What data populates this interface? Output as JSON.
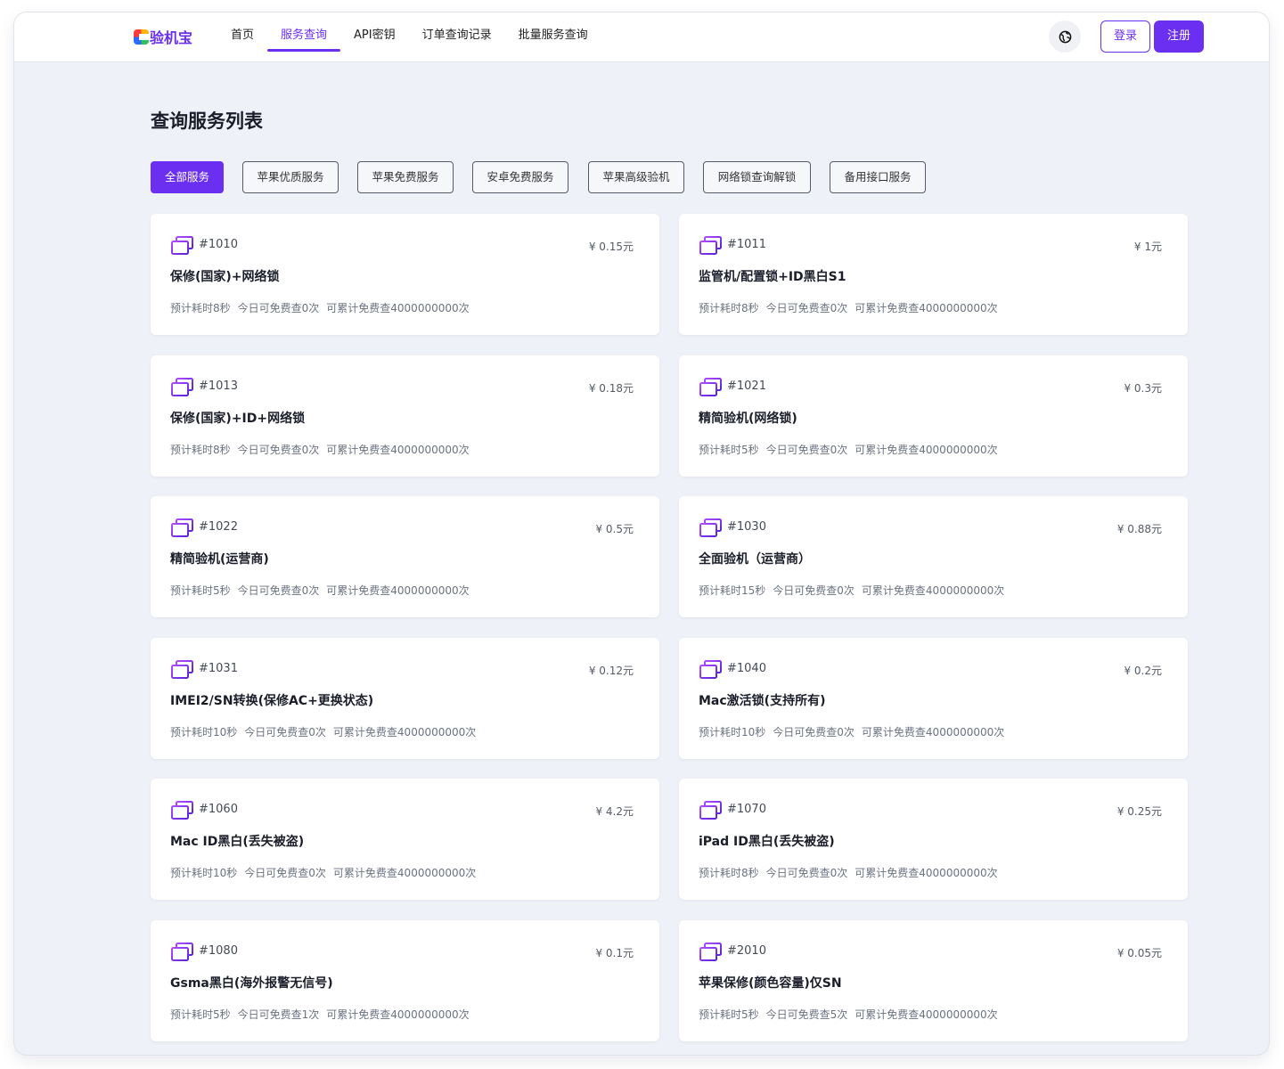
{
  "app": {
    "logo_text": "验机宝",
    "nav": [
      {
        "label": "首页"
      },
      {
        "label": "服务查询"
      },
      {
        "label": "API密钥"
      },
      {
        "label": "订单查询记录"
      },
      {
        "label": "批量服务查询"
      }
    ],
    "active_nav": "服务查询",
    "login_label": "登录",
    "register_label": "注册",
    "brand_color": "#6a2ff0"
  },
  "main": {
    "title": "查询服务列表",
    "filters": [
      {
        "label": "全部服务"
      },
      {
        "label": "苹果优质服务"
      },
      {
        "label": "苹果免费服务"
      },
      {
        "label": "安卓免费服务"
      },
      {
        "label": "苹果高级验机"
      },
      {
        "label": "网络锁查询解锁"
      },
      {
        "label": "备用接口服务"
      }
    ],
    "active_filter": "全部服务",
    "cards": [
      {
        "id": "#1010",
        "price": "¥ 0.15元",
        "title": "保修(国家)+网络锁",
        "time": "预计耗时8秒",
        "today_free": "今日可免费查0次",
        "total_free": "可累计免费查4000000000次"
      },
      {
        "id": "#1011",
        "price": "¥ 1元",
        "title": "监管机/配置锁+ID黑白S1",
        "time": "预计耗时8秒",
        "today_free": "今日可免费查0次",
        "total_free": "可累计免费查4000000000次"
      },
      {
        "id": "#1013",
        "price": "¥ 0.18元",
        "title": "保修(国家)+ID+网络锁",
        "time": "预计耗时8秒",
        "today_free": "今日可免费查0次",
        "total_free": "可累计免费查4000000000次"
      },
      {
        "id": "#1021",
        "price": "¥ 0.3元",
        "title": "精简验机(网络锁)",
        "time": "预计耗时5秒",
        "today_free": "今日可免费查0次",
        "total_free": "可累计免费查4000000000次"
      },
      {
        "id": "#1022",
        "price": "¥ 0.5元",
        "title": "精简验机(运营商)",
        "time": "预计耗时5秒",
        "today_free": "今日可免费查0次",
        "total_free": "可累计免费查4000000000次"
      },
      {
        "id": "#1030",
        "price": "¥ 0.88元",
        "title": "全面验机（运营商）",
        "time": "预计耗时15秒",
        "today_free": "今日可免费查0次",
        "total_free": "可累计免费查4000000000次"
      },
      {
        "id": "#1031",
        "price": "¥ 0.12元",
        "title": "IMEI2/SN转换(保修AC+更换状态)",
        "time": "预计耗时10秒",
        "today_free": "今日可免费查0次",
        "total_free": "可累计免费查4000000000次"
      },
      {
        "id": "#1040",
        "price": "¥ 0.2元",
        "title": "Mac激活锁(支持所有)",
        "time": "预计耗时10秒",
        "today_free": "今日可免费查0次",
        "total_free": "可累计免费查4000000000次"
      },
      {
        "id": "#1060",
        "price": "¥ 4.2元",
        "title": "Mac ID黑白(丢失被盗)",
        "time": "预计耗时10秒",
        "today_free": "今日可免费查0次",
        "total_free": "可累计免费查4000000000次"
      },
      {
        "id": "#1070",
        "price": "¥ 0.25元",
        "title": "iPad ID黑白(丢失被盗)",
        "time": "预计耗时8秒",
        "today_free": "今日可免费查0次",
        "total_free": "可累计免费查4000000000次"
      },
      {
        "id": "#1080",
        "price": "¥ 0.1元",
        "title": "Gsma黑白(海外报警无信号)",
        "time": "预计耗时5秒",
        "today_free": "今日可免费查1次",
        "total_free": "可累计免费查4000000000次"
      },
      {
        "id": "#2010",
        "price": "¥ 0.05元",
        "title": "苹果保修(颜色容量)仅SN",
        "time": "预计耗时5秒",
        "today_free": "今日可免费查5次",
        "total_free": "可累计免费查4000000000次"
      }
    ]
  }
}
